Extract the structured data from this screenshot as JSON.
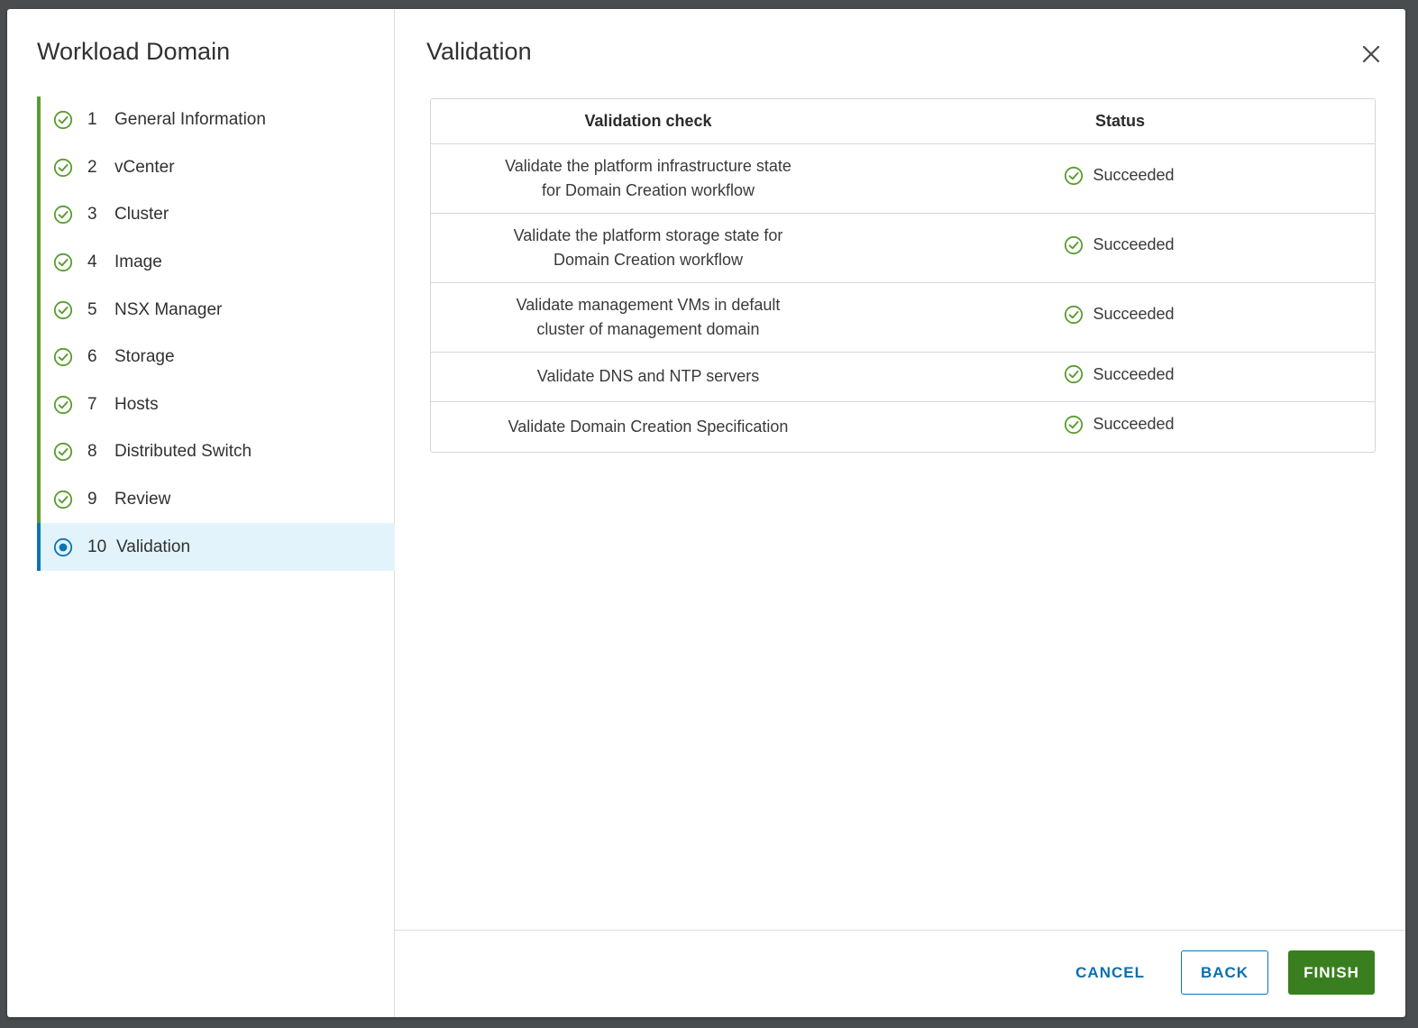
{
  "colors": {
    "complete_green": "#5a9c2f",
    "current_blue": "#0c74b3",
    "current_bg": "#e2f3fb",
    "finish_button": "#3a7f1f",
    "link_blue": "#0b6fb0"
  },
  "wizard": {
    "title": "Workload Domain",
    "steps": [
      {
        "number": "1",
        "label": "General Information",
        "state": "complete",
        "icon": "check-circle-icon"
      },
      {
        "number": "2",
        "label": "vCenter",
        "state": "complete",
        "icon": "check-circle-icon"
      },
      {
        "number": "3",
        "label": "Cluster",
        "state": "complete",
        "icon": "check-circle-icon"
      },
      {
        "number": "4",
        "label": "Image",
        "state": "complete",
        "icon": "check-circle-icon"
      },
      {
        "number": "5",
        "label": "NSX Manager",
        "state": "complete",
        "icon": "check-circle-icon"
      },
      {
        "number": "6",
        "label": "Storage",
        "state": "complete",
        "icon": "check-circle-icon"
      },
      {
        "number": "7",
        "label": "Hosts",
        "state": "complete",
        "icon": "check-circle-icon"
      },
      {
        "number": "8",
        "label": "Distributed Switch",
        "state": "complete",
        "icon": "check-circle-icon"
      },
      {
        "number": "9",
        "label": "Review",
        "state": "complete",
        "icon": "check-circle-icon"
      },
      {
        "number": "10",
        "label": "Validation",
        "state": "current",
        "icon": "radio-dot-icon"
      }
    ]
  },
  "content": {
    "title": "Validation",
    "close_icon": "close-icon",
    "table": {
      "columns": [
        "Validation check",
        "Status"
      ],
      "rows": [
        {
          "check_line1": "Validate the platform infrastructure state",
          "check_line2": "for Domain Creation workflow",
          "status": "Succeeded"
        },
        {
          "check_line1": "Validate the platform storage state for",
          "check_line2": "Domain Creation workflow",
          "status": "Succeeded"
        },
        {
          "check_line1": "Validate management VMs in default",
          "check_line2": "cluster of management domain",
          "status": "Succeeded"
        },
        {
          "check_line1": "Validate DNS and NTP servers",
          "check_line2": "",
          "status": "Succeeded"
        },
        {
          "check_line1": "Validate Domain Creation Specification",
          "check_line2": "",
          "status": "Succeeded"
        }
      ]
    }
  },
  "footer": {
    "cancel_label": "CANCEL",
    "back_label": "BACK",
    "finish_label": "FINISH"
  }
}
